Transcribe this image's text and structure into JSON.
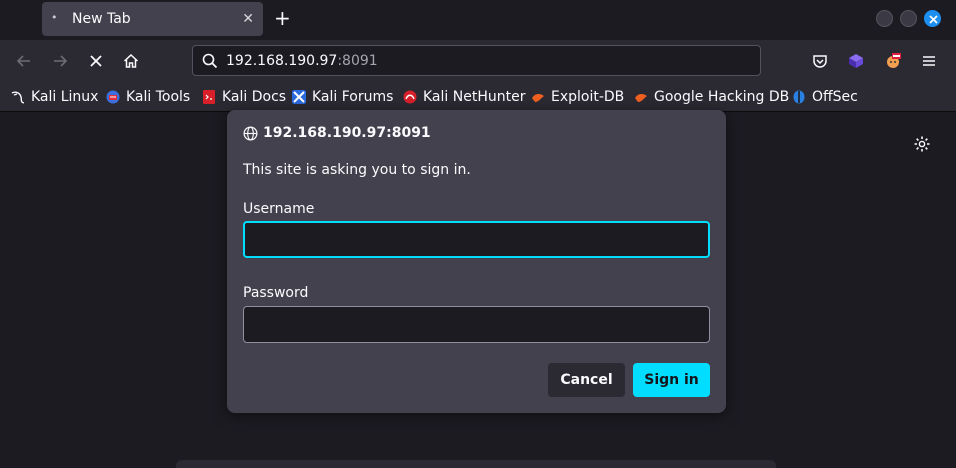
{
  "tab": {
    "title": "New Tab",
    "loading_glyph": "•",
    "close_glyph": "✕"
  },
  "tabstrip": {
    "newtab_glyph": "+"
  },
  "urlbar": {
    "host": "192.168.190.97",
    "port": ":8091"
  },
  "bookmarks": [
    {
      "label": "Kali Linux",
      "icon": "kali-dragon-icon"
    },
    {
      "label": "Kali Tools",
      "icon": "kali-tools-icon"
    },
    {
      "label": "Kali Docs",
      "icon": "kali-docs-icon"
    },
    {
      "label": "Kali Forums",
      "icon": "kali-forums-icon"
    },
    {
      "label": "Kali NetHunter",
      "icon": "kali-nethunter-icon"
    },
    {
      "label": "Exploit-DB",
      "icon": "exploit-db-icon"
    },
    {
      "label": "Google Hacking DB",
      "icon": "ghdb-icon"
    },
    {
      "label": "OffSec",
      "icon": "offsec-icon"
    }
  ],
  "dialog": {
    "origin": "192.168.190.97:8091",
    "message": "This site is asking you to sign in.",
    "username_label": "Username",
    "username_value": "",
    "password_label": "Password",
    "password_value": "",
    "cancel_label": "Cancel",
    "signin_label": "Sign in"
  },
  "colors": {
    "accent": "#00ddff",
    "background": "#1c1b22",
    "toolbar": "#2b2a33",
    "dialog": "#42414d"
  }
}
